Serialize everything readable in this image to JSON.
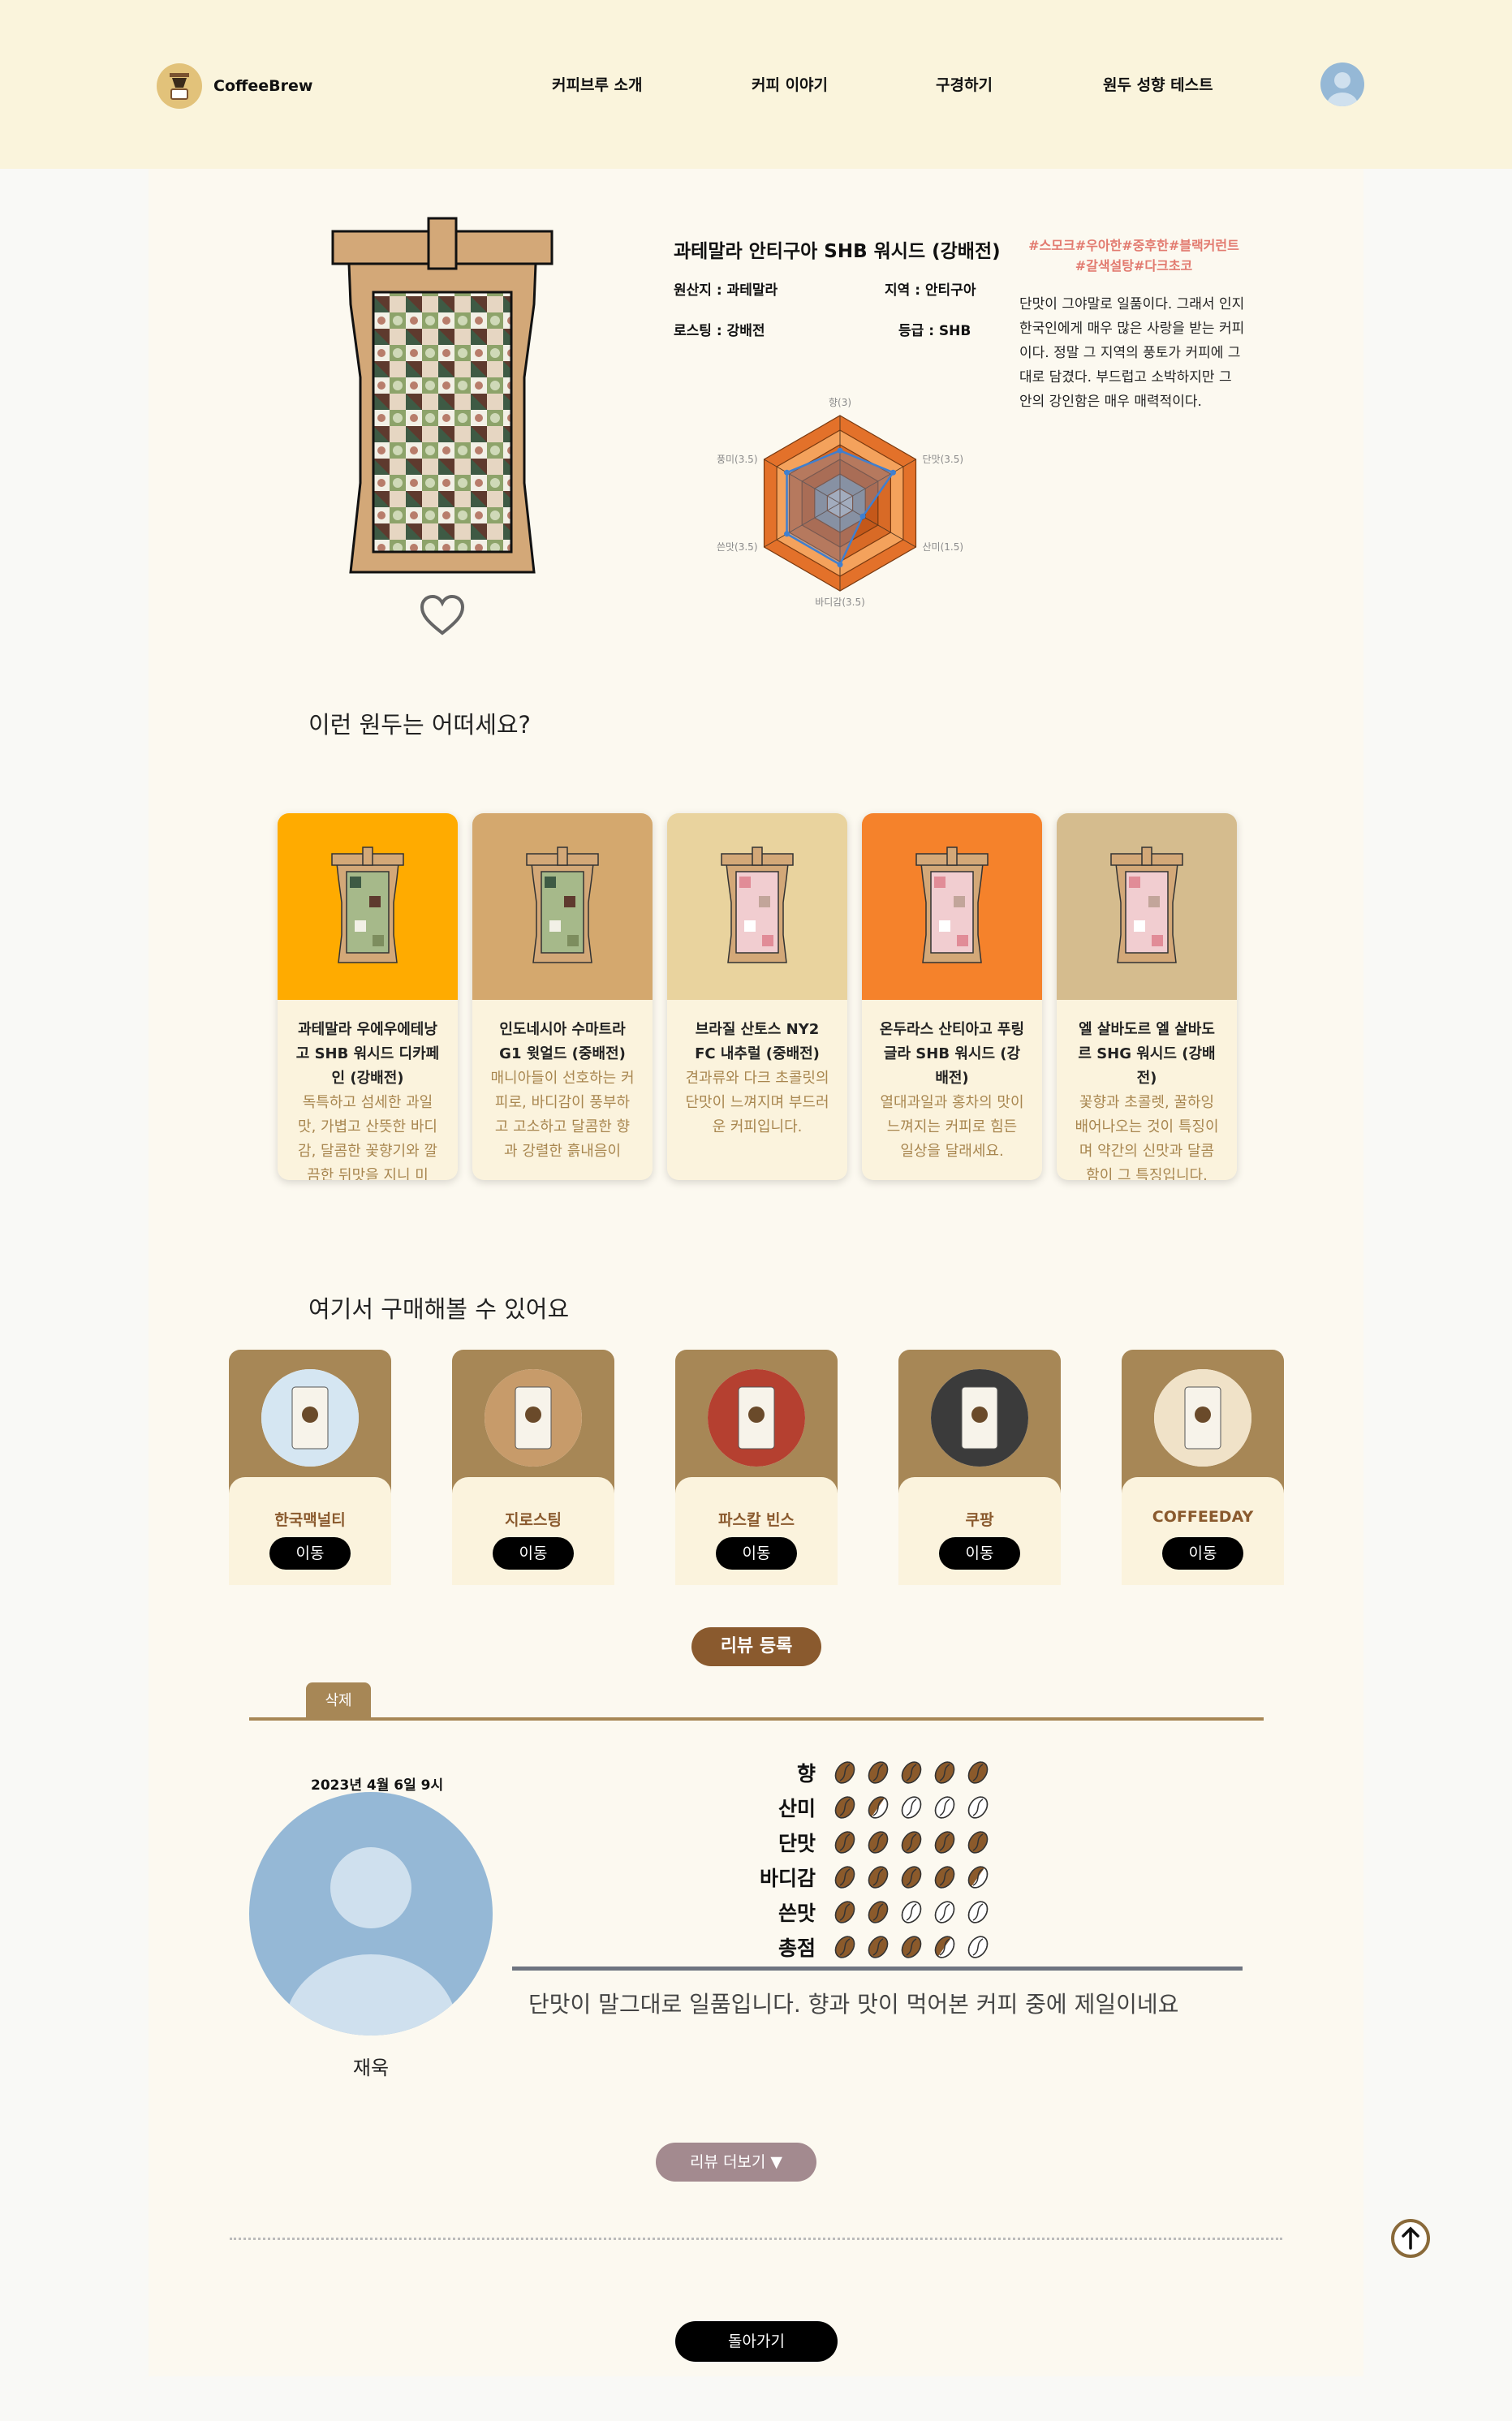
{
  "header": {
    "logo_text": "CoffeeBrew",
    "nav": [
      "커피브루 소개",
      "커피 이야기",
      "구경하기",
      "원두 성향 테스트"
    ]
  },
  "product": {
    "title": "과테말라 안티구아 SHB 워시드 (강배전)",
    "origin": "원산지 : 과테말라",
    "region": "지역 : 안티구아",
    "roasting": "로스팅 : 강배전",
    "grade": "등급 : SHB",
    "tags_line1": "#스모크#우아한#중후한#블랙커런트",
    "tags_line2": "#갈색설탕#다크초코",
    "description": "단맛이 그야말로 일품이다. 그래서 인지 한국인에게 매우 많은 사랑을 받는 커피이다. 정말 그 지역의 풍토가 커피에 그대로 담겼다. 부드럽고 소박하지만 그 안의 강인함은 매우 매력적이다.",
    "radar": {
      "labels": [
        "향(3)",
        "단맛(3.5)",
        "산미(1.5)",
        "바디감(3.5)",
        "쓴맛(3.5)",
        "풍미(3.5)"
      ],
      "values": [
        3,
        3.5,
        1.5,
        3.5,
        3.5,
        3.5
      ],
      "max": 5,
      "colors": [
        "#f3d9b8",
        "#f2a55f",
        "#d9702c",
        "#c0571a",
        "#9b9b9b",
        "#bcbcbc"
      ]
    }
  },
  "recommend": {
    "title": "이런 원두는 어떠세요?",
    "items": [
      {
        "name": "과테말라 우에우에테낭고 SHB 워시드 디카페인 (강배전)",
        "desc": "독특하고 섬세한 과일맛, 가볍고 산뜻한 바디감, 달콤한 꽃향기와 깔끔한 뒤맛을 지니 미",
        "color": "#ffab00"
      },
      {
        "name": "인도네시아 수마트라 G1 윗얼드 (중배전)",
        "desc": "매니아들이 선호하는 커피로, 바디감이 풍부하고 고소하고 달콤한 향과 강렬한 흙내음이",
        "color": "#d4a86e"
      },
      {
        "name": "브라질 산토스 NY2 FC 내추럴 (중배전)",
        "desc": "견과류와 다크 초콜릿의 단맛이 느껴지며 부드러운 커피입니다.",
        "color": "#e9d39e"
      },
      {
        "name": "온두라스 산티아고 푸링글라 SHB 워시드 (강배전)",
        "desc": "열대과일과 홍차의 맛이 느껴지는 커피로 힘든 일상을 달래세요.",
        "color": "#f5822b"
      },
      {
        "name": "엘 살바도르 엘 살바도르 SHG 워시드 (강배전)",
        "desc": "꽃향과 초콜렛, 꿀하잉배어나오는 것이 특징이며 약간의 신맛과 달콤함이 그 특징입니다.",
        "color": "#d5bc8e"
      }
    ]
  },
  "shops": {
    "title": "여기서 구매해볼 수 있어요",
    "button_label": "이동",
    "items": [
      {
        "name": "한국맥널티"
      },
      {
        "name": "지로스팅"
      },
      {
        "name": "파스칼 빈스"
      },
      {
        "name": "쿠팡"
      },
      {
        "name": "COFFEEDAY"
      }
    ]
  },
  "review": {
    "register_label": "리뷰 등록",
    "delete_label": "삭제",
    "date": "2023년 4월 6일 9시",
    "user": "재욱",
    "ratings": [
      {
        "label": "향",
        "score": 5
      },
      {
        "label": "산미",
        "score": 1.5
      },
      {
        "label": "단맛",
        "score": 5
      },
      {
        "label": "바디감",
        "score": 4.5
      },
      {
        "label": "쓴맛",
        "score": 2
      },
      {
        "label": "총점",
        "score": 3.5
      }
    ],
    "text": "단맛이 말그대로 일품입니다. 향과 맛이 먹어본 커피 중에 제일이네요",
    "more_label": "리뷰 더보기 ▼"
  },
  "footer": {
    "back_label": "돌아가기"
  }
}
